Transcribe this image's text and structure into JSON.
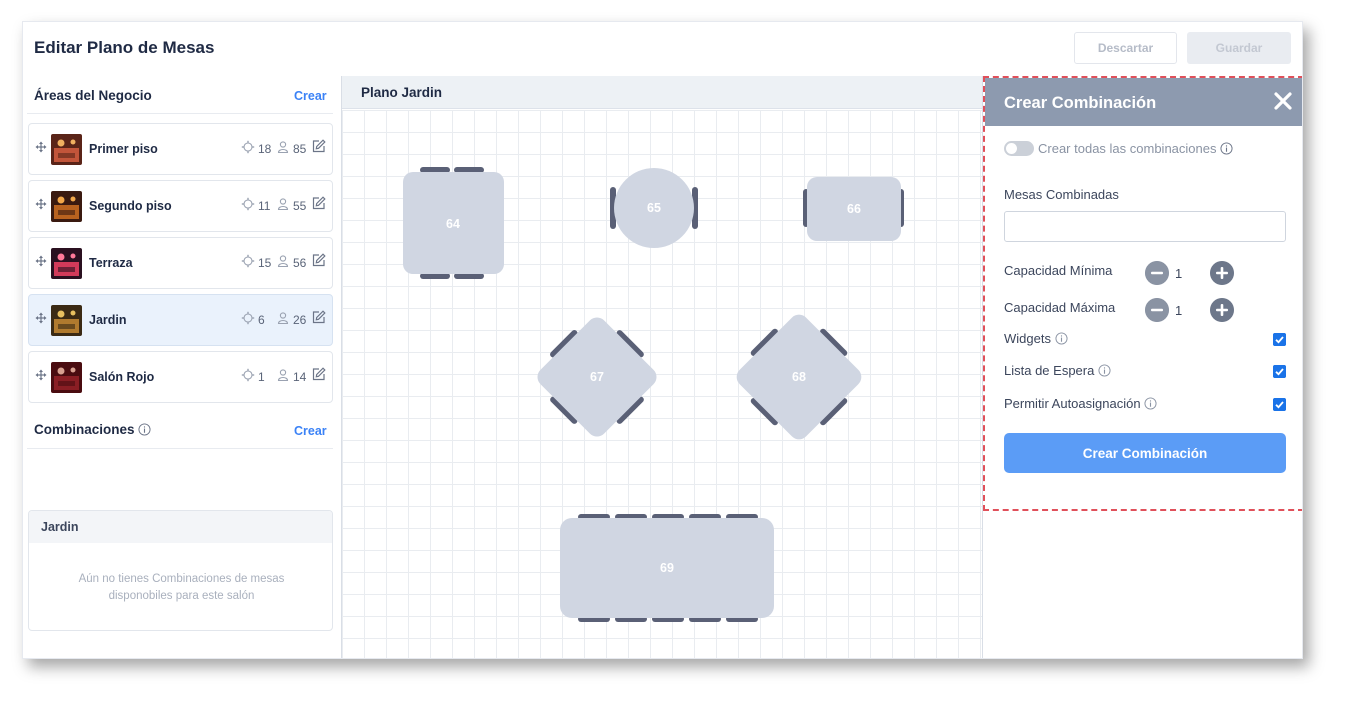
{
  "header": {
    "title": "Editar Plano de Mesas",
    "discard_label": "Descartar",
    "save_label": "Guardar"
  },
  "areas": {
    "heading": "Áreas del Negocio",
    "create_label": "Crear",
    "items": [
      {
        "name": "Primer piso",
        "tables": "18",
        "people": "85",
        "active": false
      },
      {
        "name": "Segundo piso",
        "tables": "11",
        "people": "55",
        "active": false
      },
      {
        "name": "Terraza",
        "tables": "15",
        "people": "56",
        "active": false
      },
      {
        "name": "Jardin",
        "tables": "6",
        "people": "26",
        "active": true
      },
      {
        "name": "Salón Rojo",
        "tables": "1",
        "people": "14",
        "active": false
      }
    ]
  },
  "combinations": {
    "heading": "Combinaciones",
    "create_label": "Crear",
    "area_label": "Jardin",
    "empty_text": "Aún no tienes Combinaciones de mesas disponobiles para este salón"
  },
  "canvas": {
    "title": "Plano Jardin",
    "tables": [
      "64",
      "65",
      "66",
      "67",
      "68",
      "69"
    ]
  },
  "combo_panel": {
    "title": "Crear Combinación",
    "toggle_label": "Crear todas las combinaciones",
    "toggle_on": false,
    "tables_label": "Mesas Combinadas",
    "tables_value": "",
    "min_label": "Capacidad Mínima",
    "min_value": "1",
    "max_label": "Capacidad Máxima",
    "max_value": "1",
    "widgets_label": "Widgets",
    "widgets_checked": true,
    "waitlist_label": "Lista de Espera",
    "waitlist_checked": true,
    "autoassign_label": "Permitir Autoasignación",
    "autoassign_checked": true,
    "submit_label": "Crear Combinación"
  },
  "colors": {
    "accent": "#3b82f6",
    "primary_button": "#5b9cf6",
    "panel_header": "#8d9aaf",
    "highlight_outline": "#e0505a",
    "table_fill": "#d0d6e2",
    "chair_fill": "#5a6076",
    "checkbox": "#1a73e8"
  }
}
